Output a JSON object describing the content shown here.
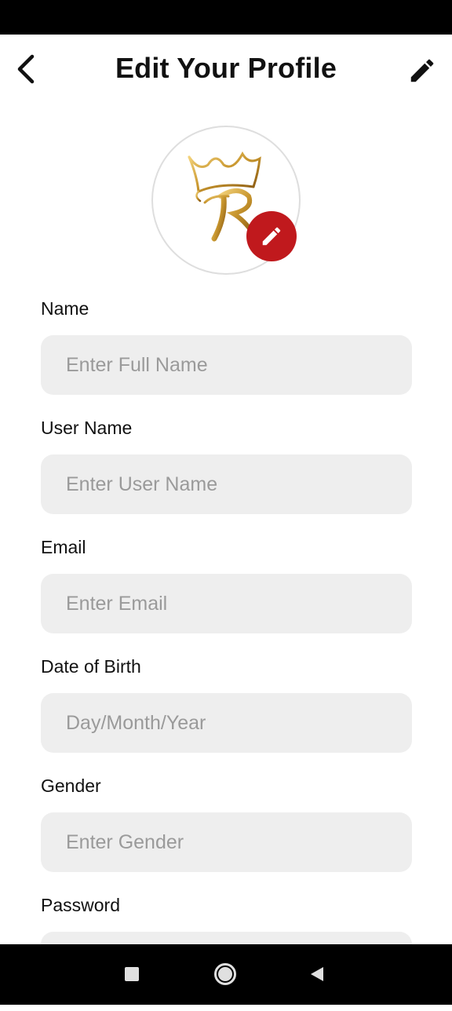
{
  "header": {
    "title": "Edit Your Profile",
    "back_icon": "chevron-left-icon",
    "edit_icon": "pencil-icon"
  },
  "avatar": {
    "logo": "crown-r-logo",
    "edit_icon": "pencil-icon",
    "edit_badge_color": "#c0191d"
  },
  "form": {
    "fields": [
      {
        "label": "Name",
        "placeholder": "Enter Full Name",
        "value": ""
      },
      {
        "label": "User Name",
        "placeholder": "Enter User Name",
        "value": ""
      },
      {
        "label": "Email",
        "placeholder": "Enter Email",
        "value": ""
      },
      {
        "label": "Date of Birth",
        "placeholder": "Day/Month/Year",
        "value": ""
      },
      {
        "label": "Gender",
        "placeholder": "Enter Gender",
        "value": ""
      },
      {
        "label": "Password",
        "placeholder": "",
        "value": ""
      }
    ]
  },
  "nav": {
    "recents_icon": "square-icon",
    "home_icon": "circle-icon",
    "back_icon": "triangle-back-icon"
  }
}
